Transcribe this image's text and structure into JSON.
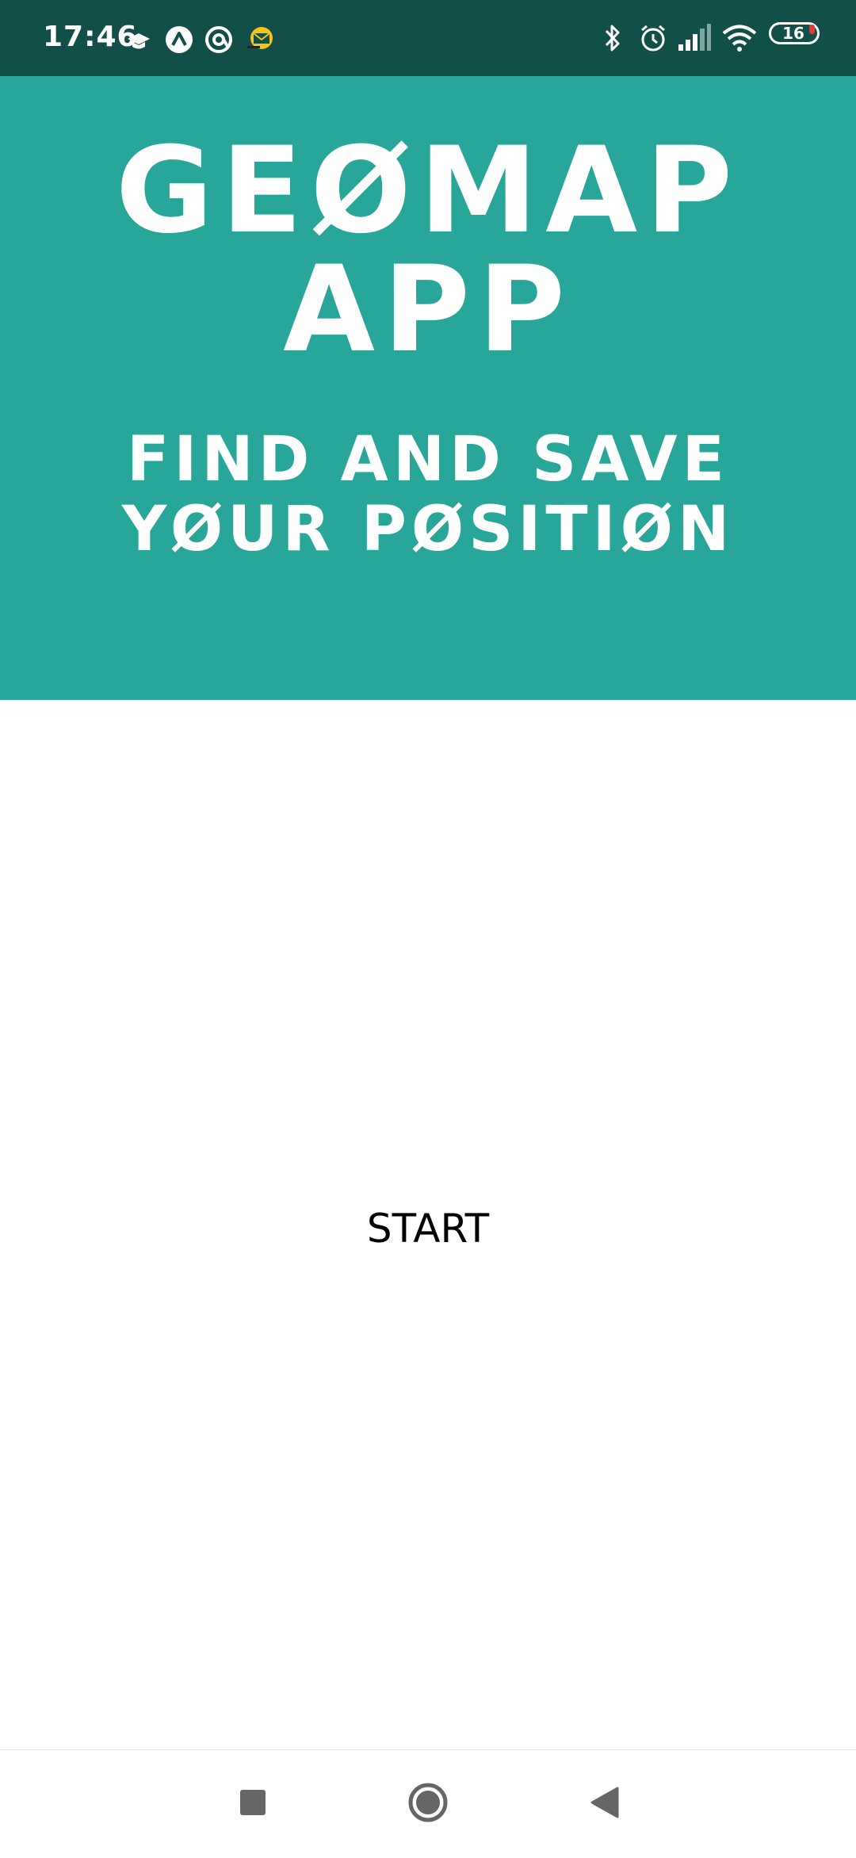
{
  "status_bar": {
    "time": "17:46",
    "battery_level": "16",
    "icons_left": [
      "graduation-cap-icon",
      "arc-app-icon",
      "at-circle-icon",
      "mail-notification-icon"
    ],
    "icons_right": [
      "bluetooth-icon",
      "alarm-icon",
      "signal-icon",
      "wifi-icon",
      "battery-icon"
    ]
  },
  "header": {
    "title": "GEØMAP\nAPP",
    "subtitle": "FIND AND SAVE\nYØUR PØSITIØN",
    "background_color": "#28a69a"
  },
  "main": {
    "start_label": "START"
  },
  "nav_bar": {
    "buttons": [
      "recents-square-icon",
      "home-circle-icon",
      "back-triangle-icon"
    ]
  }
}
